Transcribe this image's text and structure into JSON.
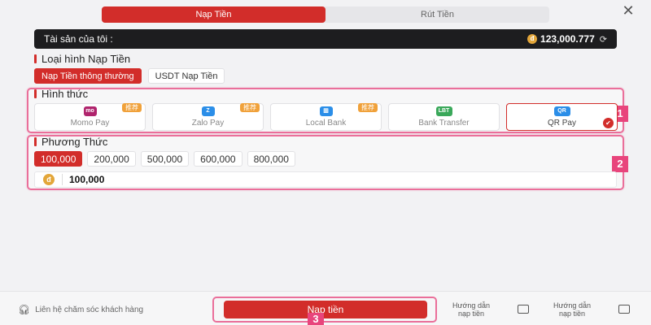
{
  "tabs": [
    {
      "label": "Nạp Tiền",
      "active": true
    },
    {
      "label": "Rút Tiền",
      "active": false
    }
  ],
  "close_icon": "close-icon",
  "assets": {
    "label": "Tài sản của tôi :",
    "coin_symbol": "đ",
    "amount": "123,000.777",
    "refresh_icon": "refresh-icon"
  },
  "deposit_type": {
    "title": "Loại hình Nạp Tiền",
    "options": [
      {
        "label": "Nạp Tiền thông thường",
        "active": true
      },
      {
        "label": "USDT Nạp Tiền",
        "active": false
      }
    ]
  },
  "method_section": {
    "title": "Hình thức",
    "marker": "1",
    "methods": [
      {
        "label": "Momo Pay",
        "icon": "momo-icon",
        "icon_text": "mo",
        "icon_color": "#b0246d",
        "tag": "推荐",
        "selected": false
      },
      {
        "label": "Zalo Pay",
        "icon": "zalo-icon",
        "icon_text": "Z",
        "icon_color": "#2b8ee8",
        "tag": "推荐",
        "selected": false
      },
      {
        "label": "Local Bank",
        "icon": "bank-icon",
        "icon_text": "▥",
        "icon_color": "#2b8ee8",
        "tag": "推荐",
        "selected": false
      },
      {
        "label": "Bank Transfer",
        "icon": "bank-transfer-icon",
        "icon_text": "LBT",
        "icon_color": "#3aa85a",
        "tag": "",
        "selected": false
      },
      {
        "label": "QR Pay",
        "icon": "qr-pay-icon",
        "icon_text": "QR",
        "icon_color": "#2b8ee8",
        "tag": "",
        "selected": true
      }
    ]
  },
  "amount_section": {
    "title": "Phương Thức",
    "marker": "2",
    "presets": [
      {
        "label": "100,000",
        "active": true
      },
      {
        "label": "200,000",
        "active": false
      },
      {
        "label": "500,000",
        "active": false
      },
      {
        "label": "600,000",
        "active": false
      },
      {
        "label": "800,000",
        "active": false
      }
    ],
    "coin_symbol": "đ",
    "input_value": "100,000"
  },
  "footer": {
    "support_label": "Liên hệ chăm sóc khách hàng",
    "submit_label": "Nạp tiền",
    "marker": "3",
    "guide1_line1": "Hướng dẫn",
    "guide1_line2": "nạp tiền",
    "guide2_line1": "Hướng dẫn",
    "guide2_line2": "nạp tiền"
  },
  "colors": {
    "accent": "#d22d2a",
    "highlight": "#ea6f9a",
    "marker": "#e8457c",
    "coin": "#e3a63a"
  }
}
